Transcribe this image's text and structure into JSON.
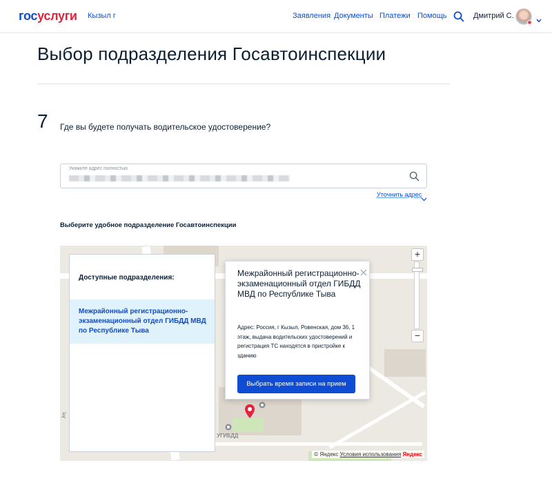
{
  "header": {
    "logo_part1": "гос",
    "logo_part2": "услуги",
    "city": "Кызыл г",
    "nav": [
      "Заявления",
      "Документы",
      "Платежи",
      "Помощь"
    ],
    "user_name": "Дмитрий С."
  },
  "page": {
    "title": "Выбор подразделения Госавтоинспекции",
    "step_number": "7",
    "question": "Где вы будете получать водительское удостоверение?"
  },
  "address": {
    "label": "Укажите адрес полностью",
    "clarify_link": "Уточнить адрес"
  },
  "choose_label": "Выберите удобное подразделение Госавтоинспекции",
  "list_panel": {
    "title": "Доступные подразделения:",
    "items": [
      {
        "label": "Межрайонный регистрационно-экзаменационный отдел ГИБДД МВД по Республике Тыва"
      }
    ]
  },
  "popup": {
    "title": "Межрайонный регистрационно-экзаменационный отдел ГИБДД МВД по Республике Тыва",
    "address": "Адрес: Россия, г Кызыл, Ровенская, дом 36, 1 этаж, выдача водительских удостоверений и регистрация ТС находятся в пристройке к зданию",
    "button_label": "Выбрать время записи на прием"
  },
  "map": {
    "poi_label": "УГИБДД",
    "street_label": "ул.",
    "zoom_in": "+",
    "zoom_out": "−",
    "copyright": "© Яндекс",
    "terms_link": "Условия использования",
    "brand": "Яндекс"
  },
  "colors": {
    "accent": "#0d4cd3",
    "brand_red": "#e3243b",
    "selected_bg": "#e0f2fb",
    "pin": "#e3243b"
  }
}
